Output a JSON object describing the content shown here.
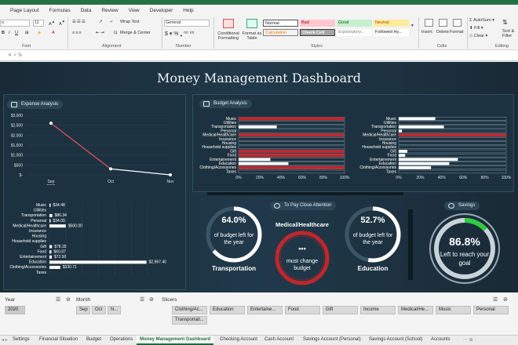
{
  "ribbon": {
    "tabs": [
      "Page Layout",
      "Formulas",
      "Data",
      "Review",
      "View",
      "Developer",
      "Help"
    ],
    "font_name": "n",
    "font_size": "11",
    "wrap_text": "Wrap Text",
    "merge_center": "Merge & Center",
    "number_format": "General",
    "cond_format": "Conditional Formatting",
    "format_table": "Format as Table",
    "styles": [
      {
        "label": "Normal",
        "bg": "#ffffff",
        "fg": "#222222"
      },
      {
        "label": "Bad",
        "bg": "#ffc7ce",
        "fg": "#9c0006"
      },
      {
        "label": "Good",
        "bg": "#c6efce",
        "fg": "#006100"
      },
      {
        "label": "Neutral",
        "bg": "#ffeb9c",
        "fg": "#9c5700"
      },
      {
        "label": "Calculation",
        "bg": "#f2f2f2",
        "fg": "#fa7d00"
      },
      {
        "label": "Check Cell",
        "bg": "#a5a5a5",
        "fg": "#ffffff"
      },
      {
        "label": "Explanatory...",
        "bg": "#ffffff",
        "fg": "#7f7f7f"
      },
      {
        "label": "Followed Hy...",
        "bg": "#ffffff",
        "fg": "#222222"
      }
    ],
    "insert": "Insert",
    "delete": "Delete",
    "format": "Format",
    "autosum": "AutoSum",
    "fill": "Fill",
    "clear": "Clear",
    "sort": "Sort & Filter",
    "groups": {
      "font": "Font",
      "alignment": "Alignment",
      "number": "Number",
      "styles": "Styles",
      "cells": "Cells",
      "editing": "Editing"
    }
  },
  "dashboard": {
    "title": "Money Management Dashboard",
    "expense_title": "Expense Analysis",
    "budget_title": "Budget Analysis",
    "attention_title": "To Pay Close Attention",
    "savings_title": "Savings",
    "transport": {
      "pct": "64.0%",
      "text": "of budget left for the year",
      "label": "Transportation"
    },
    "medical": {
      "title": "Medical/Healthcare",
      "dots": "•••",
      "text": "must change budget"
    },
    "education": {
      "pct": "52.7%",
      "text": "of budget left for the year",
      "label": "Education"
    },
    "savings": {
      "pct": "86.8%",
      "text": "Left to reach your goal"
    }
  },
  "chart_data": [
    {
      "type": "line",
      "title": "",
      "categories": [
        "Sep 2020",
        "Oct",
        "Nov"
      ],
      "values": [
        2600,
        300,
        0
      ],
      "ylim": [
        0,
        3000
      ],
      "yticks": [
        "$3,000",
        "$2,500",
        "$2,000",
        "$1,500",
        "$1,000",
        "$500",
        "$-"
      ]
    },
    {
      "type": "bar",
      "categories": [
        "Music",
        "Utilities",
        "Transportation",
        "Personal",
        "Medical/Healthcare",
        "Insurance",
        "Housing",
        "Household supplies",
        "Gift",
        "Food",
        "Entertainement",
        "Education",
        "Clothing/Accessories",
        "Taxes"
      ],
      "values": [
        34.48,
        0,
        86.34,
        34.0,
        500.0,
        0,
        0,
        0,
        78.35,
        60.87,
        72.5,
        2967.4,
        330.71,
        0
      ],
      "data_labels": [
        "$34.48",
        "",
        "$86.34",
        "$34.00",
        "$500.00",
        "",
        "",
        "",
        "$78.35",
        "$60.87",
        "$72.50",
        "$2,967.40",
        "$330.71",
        ""
      ],
      "xlim": [
        0,
        3000
      ]
    },
    {
      "type": "bar",
      "categories": [
        "Music",
        "Utilities",
        "Transportation",
        "Personal",
        "Medical/Healthcare",
        "Insurance",
        "Housing",
        "Household supplies",
        "Gift",
        "Food",
        "Entertainement",
        "Education",
        "Clothing/Accessories",
        "Taxes"
      ],
      "values": [
        100,
        0,
        36,
        0,
        100,
        0,
        0,
        0,
        100,
        100,
        30,
        47,
        100,
        0
      ],
      "xticks": [
        "0%",
        "20%",
        "40%",
        "60%",
        "80%",
        "100%"
      ]
    },
    {
      "type": "bar",
      "categories": [
        "Music",
        "Utilities",
        "Transportation",
        "Personal",
        "Medical/Healthcare",
        "Insurance",
        "Housing",
        "Household supplies",
        "Gift",
        "Food",
        "Entertainement",
        "Education",
        "Clothing/Accessories",
        "Taxes"
      ],
      "values": [
        34,
        0,
        42,
        3,
        100,
        0,
        0,
        0,
        8,
        6,
        55,
        47,
        30,
        0
      ],
      "xticks": [
        "0%",
        "20%",
        "40%",
        "60%",
        "80%",
        "100%"
      ]
    }
  ],
  "lower": {
    "year_label": "Year",
    "year_value": "2020",
    "month_label": "Month",
    "months": [
      "Sep",
      "Oct",
      "N..."
    ],
    "slicers_label": "Slicers",
    "slicers": [
      "Clothing/Ac...",
      "Education",
      "Entertaine...",
      "Food",
      "Gift",
      "Income",
      "Medical/He...",
      "Music",
      "Personal",
      "Transportati..."
    ]
  },
  "sheets": [
    "Settings",
    "Financial Situation",
    "Budget",
    "Operations",
    "Money Management Dashboard",
    "Checking Account",
    "Cash Account",
    "Savings Account (Personal)",
    "Savings Account (School)",
    "Accounts"
  ],
  "colors": {
    "accent_red": "#c0262e",
    "gauge_white": "#ffffff",
    "savings_green": "#2ecc40"
  }
}
